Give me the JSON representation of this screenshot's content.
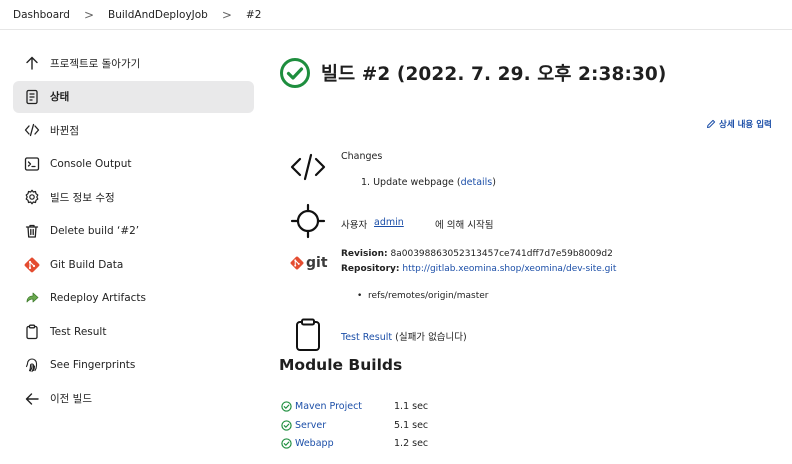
{
  "breadcrumb": {
    "items": [
      "Dashboard",
      "BuildAndDeployJob",
      "#2"
    ],
    "separator": ">"
  },
  "sidebar": {
    "items": [
      {
        "label": "프로젝트로 돌아가기",
        "icon": "arrow-up-icon"
      },
      {
        "label": "상태",
        "icon": "document-icon",
        "active": true
      },
      {
        "label": "바뀐점",
        "icon": "code-icon"
      },
      {
        "label": "Console Output",
        "icon": "terminal-icon"
      },
      {
        "label": "빌드 정보 수정",
        "icon": "gear-icon"
      },
      {
        "label": "Delete build ‘#2’",
        "icon": "trash-icon"
      },
      {
        "label": "Git Build Data",
        "icon": "git-icon"
      },
      {
        "label": "Redeploy Artifacts",
        "icon": "redeploy-icon"
      },
      {
        "label": "Test Result",
        "icon": "clipboard-icon"
      },
      {
        "label": "See Fingerprints",
        "icon": "fingerprint-icon"
      },
      {
        "label": "이전 빌드",
        "icon": "arrow-left-icon"
      }
    ]
  },
  "main": {
    "title": "빌드 #2 (2022. 7. 29. 오후 2:38:30)",
    "edit_description": "상세 내용 입력",
    "changes": {
      "heading": "Changes",
      "item_prefix": "1. Update webpage (",
      "item_link": "details",
      "item_suffix": ")"
    },
    "started_by": {
      "prefix": "사용자",
      "user": "admin",
      "suffix": "에 의해 시작됨"
    },
    "git": {
      "logo_text": "git",
      "revision_label": "Revision:",
      "revision": "8a00398863052313457ce741dff7d7e59b8009d2",
      "repository_label": "Repository:",
      "repository": "http://gitlab.xeomina.shop/xeomina/dev-site.git",
      "branch": "refs/remotes/origin/master"
    },
    "test_result": {
      "link": "Test Result",
      "note": "(실패가 없습니다)"
    },
    "module_builds": {
      "heading": "Module Builds",
      "rows": [
        {
          "name": "Maven Project",
          "duration": "1.1 sec"
        },
        {
          "name": "Server",
          "duration": "5.1 sec"
        },
        {
          "name": "Webapp",
          "duration": "1.2 sec"
        }
      ]
    }
  },
  "colors": {
    "success": "#1e8e3e",
    "link": "#1c4fa8",
    "active_bg": "#e9e9ea",
    "git_brand": "#e44c30"
  }
}
